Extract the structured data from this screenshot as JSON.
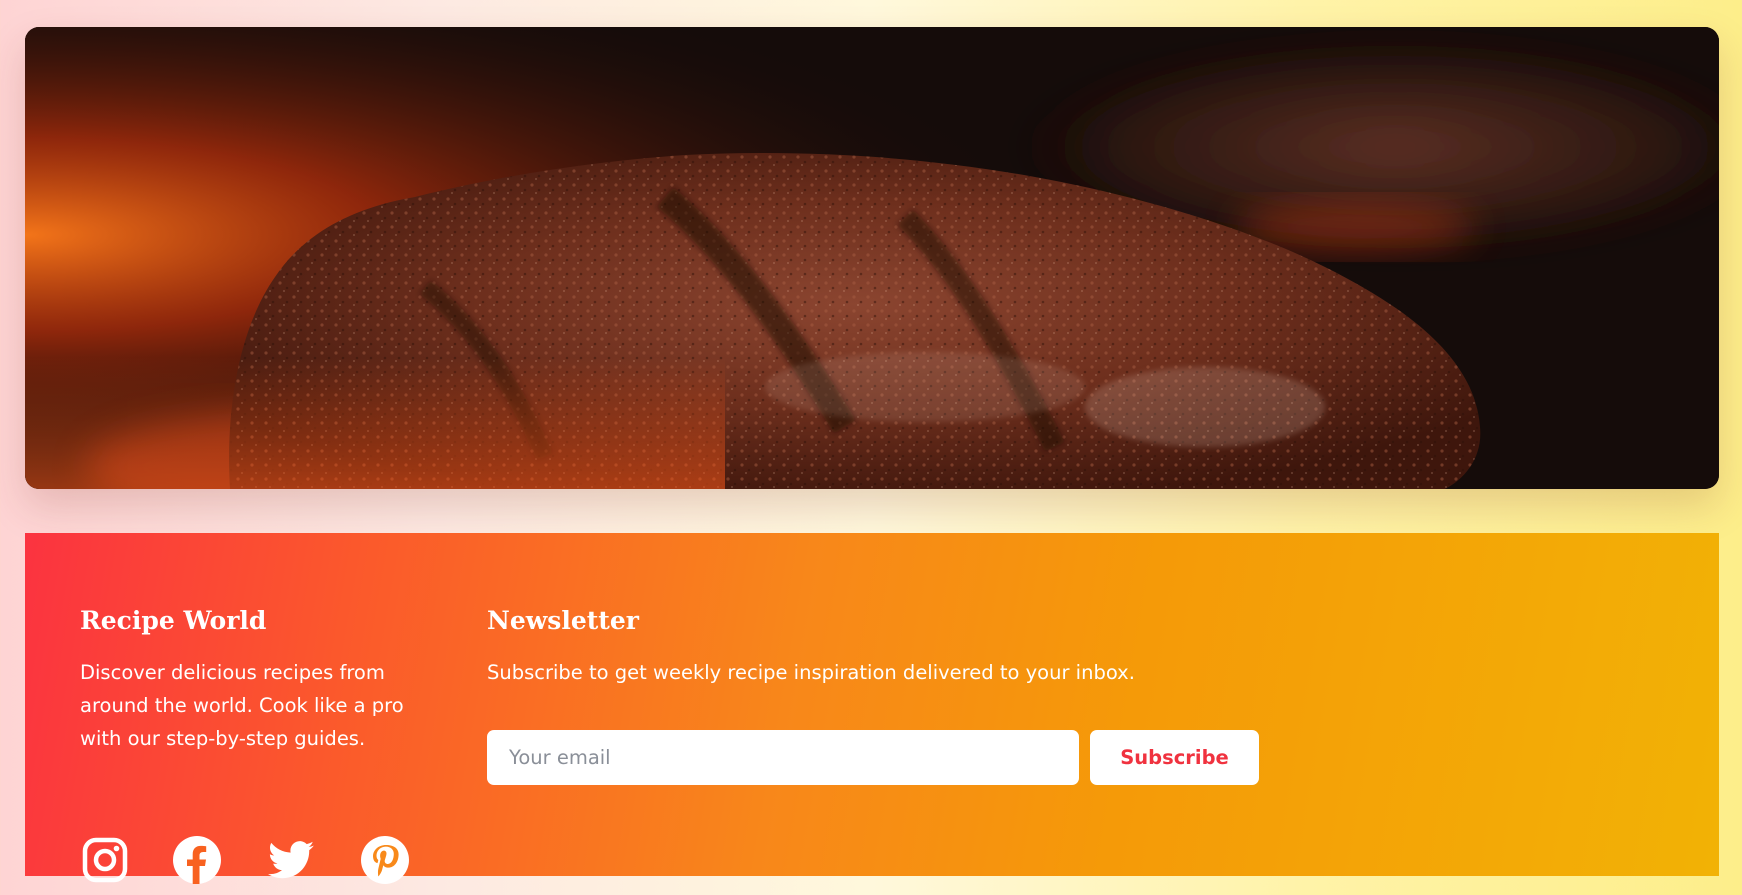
{
  "hero": {
    "image": "grilled-burger-patty-photo"
  },
  "footer": {
    "brand": {
      "title": "Recipe World",
      "description": "Discover delicious recipes from around the world. Cook like a pro with our step-by-step guides."
    },
    "newsletter": {
      "title": "Newsletter",
      "description": "Subscribe to get weekly recipe inspiration delivered to your inbox.",
      "email_placeholder": "Your email",
      "subscribe_label": "Subscribe"
    },
    "socials": [
      {
        "icon": "instagram-icon"
      },
      {
        "icon": "facebook-icon"
      },
      {
        "icon": "twitter-icon"
      },
      {
        "icon": "pinterest-icon"
      }
    ]
  },
  "colors": {
    "accent": "#f0323f",
    "footer_gradient_start": "#fb3340",
    "footer_gradient_end": "#f2b205"
  }
}
